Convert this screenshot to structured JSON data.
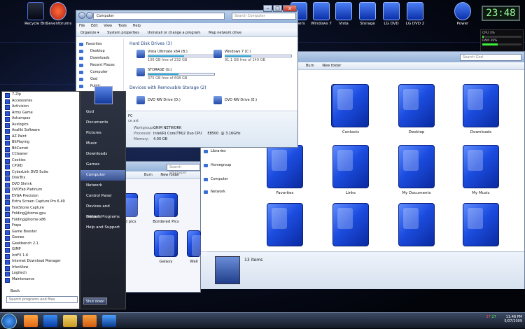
{
  "dock": {
    "left_items": [
      "Recycle Bin",
      "Sevenforums"
    ],
    "right_items": [
      "Windows 7",
      "Vista",
      "Storage",
      "LG DVD",
      "LG DVD 2",
      "Power"
    ],
    "partial_item": "...pers",
    "clock": "23:48"
  },
  "sysmon": {
    "cpu_label": "CPU",
    "cpu_value": "3%",
    "ram_label": "RAM",
    "ram_value": "39%",
    "cpu_level": 0.03,
    "ram_level": 0.39
  },
  "computer_window": {
    "address": "Computer",
    "search_placeholder": "Search Computer",
    "menu": [
      "File",
      "Edit",
      "View",
      "Tools",
      "Help"
    ],
    "commands": [
      "Organize ▾",
      "System properties",
      "Uninstall or change a program",
      "Map network drive"
    ],
    "nav": [
      "Favorites",
      "Desktop",
      "Downloads",
      "Recent Places",
      "Computer",
      "God",
      "Public"
    ],
    "hdd_header": "Hard Disk Drives (3)",
    "drives": [
      {
        "name": "Vista Ultimate x64 (B:)",
        "size": "106 GB free of 232 GB",
        "used": 0.54
      },
      {
        "name": "Windows 7 (C:)",
        "size": "91.1 GB free of 149 GB",
        "used": 0.39
      },
      {
        "name": "STORAGE (G:)",
        "size": "375 GB free of 698 GB",
        "used": 0.46
      }
    ],
    "removable_header": "Devices with Removable Storage (2)",
    "removable": [
      "DVD RW Drive (D:)",
      "DVD RW Drive (E:)"
    ],
    "details": {
      "pc_name": "PC",
      "pc_sub": "ce ast",
      "workgroup_label": "Workgroup:",
      "workgroup": "GRIM NETWORK",
      "processor_label": "Processor:",
      "processor": "Intel(R) Core(TM)2 Duo CPU     E8500  @ 3.16GHz",
      "memory_label": "Memory:",
      "memory": "4.00 GB"
    }
  },
  "user_window": {
    "search_placeholder": "Search God",
    "commands": [
      "Burn",
      "New folder"
    ],
    "nav": [
      "Libraries",
      "Homegroup",
      "Computer",
      "Network"
    ],
    "items": [
      "",
      "Contacts",
      "Desktop",
      "Downloads",
      "Favorites",
      "Links",
      "My Documents",
      "My Music",
      "",
      "",
      "",
      ""
    ],
    "status": "13 items"
  },
  "wallpaper_window": {
    "search_placeholder": "Search Wallpaper",
    "commands": [
      "Burn",
      "New folder"
    ],
    "items": [
      "and pics",
      "Bordered Pics",
      "",
      "Galaxy",
      "Wall"
    ]
  },
  "start_menu": {
    "programs": [
      "7-Zip",
      "Accessories",
      "Activision",
      "Army Game",
      "Ashampoo",
      "Auslogics",
      "Avaliki Software",
      "AZ Paint",
      "BitPlaying",
      "BitComet",
      "CCleaner",
      "Cookies",
      "CPUID",
      "CyberLink DVD Suite",
      "DiskTrix",
      "DVD Shrink",
      "DVDFab Platinum",
      "EVGA Precision",
      "Extra Screen Capture Pro 6.49",
      "FastStone Capture",
      "Folding@home-gpu",
      "Folding@home-x86",
      "Fraps",
      "Game Booster",
      "Games",
      "Geekbench 2.1",
      "GIMP",
      "IcoFX 1.6",
      "Internet Download Manager",
      "IrfanView",
      "Logitech",
      "Maintenance"
    ],
    "back": "Back",
    "search_placeholder": "Search programs and files",
    "right": [
      "God",
      "Documents",
      "Pictures",
      "Music",
      "Downloads",
      "Games",
      "Computer",
      "Network",
      "Control Panel",
      "Devices and Printers",
      "Default Programs",
      "Help and Support"
    ],
    "selected": "Computer",
    "shutdown": "Shut down"
  },
  "taskbar": {
    "time": "11:48 PM",
    "date": "5/07/2009",
    "tray_nums": [
      "27",
      "27"
    ]
  }
}
